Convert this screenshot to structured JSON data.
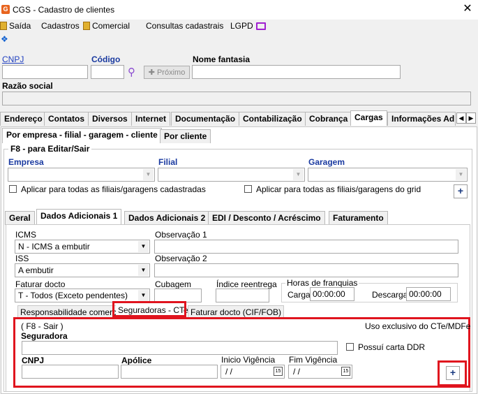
{
  "window": {
    "title": "CGS - Cadastro de clientes",
    "close": "✕"
  },
  "menu": {
    "saida": "Saída",
    "cadastros": "Cadastros",
    "comercial": "Comercial",
    "consultas": "Consultas cadastrais",
    "lgpd": "LGPD"
  },
  "top": {
    "cnpj_label": "CNPJ",
    "codigo_label": "Código",
    "proximo_label": "Próximo",
    "nome_fantasia_label": "Nome fantasia",
    "razao_social_label": "Razão social"
  },
  "main_tabs": [
    "Endereço",
    "Contatos",
    "Diversos",
    "Internet",
    "Documentação",
    "Contabilização",
    "Cobrança",
    "Cargas",
    "Informações Adi"
  ],
  "sub_tabs": [
    "Por empresa - filial - garagem - cliente",
    "Por cliente"
  ],
  "group": {
    "title": "F8 - para Editar/Sair",
    "empresa_label": "Empresa",
    "filial_label": "Filial",
    "garagem_label": "Garagem",
    "aplicar_filiais": "Aplicar para todas as filiais/garagens cadastradas",
    "aplicar_grid": "Aplicar para todas as filiais/garagens do grid",
    "add": "+"
  },
  "inner_tabs": [
    "Geral",
    "Dados Adicionais 1",
    "Dados Adicionais 2",
    "EDI / Desconto / Acréscimo",
    "Faturamento"
  ],
  "form": {
    "icms_label": "ICMS",
    "icms_value": "N - ICMS a embutir",
    "obs1_label": "Observação 1",
    "iss_label": "ISS",
    "iss_value": "A embutir",
    "obs2_label": "Observação 2",
    "faturar_label": "Faturar docto",
    "faturar_value": "T - Todos (Exceto pendentes)",
    "cubagem_label": "Cubagem",
    "indice_label": "Índice reentrega",
    "horas_label": "Horas de franquias",
    "carga_label": "Carga",
    "carga_value": "00:00:00",
    "descarga_label": "Descarga",
    "descarga_value": "00:00:00"
  },
  "bottom_tabs": [
    "Responsabilidade comercial",
    "Seguradoras - CTe",
    "Faturar docto (CIF/FOB)"
  ],
  "seguradoras": {
    "f8": "( F8 - Sair )",
    "uso": "Uso exclusivo do CTe/MDFe",
    "seguradora_label": "Seguradora",
    "possui_ddr": "Possuí carta DDR",
    "cnpj_label": "CNPJ",
    "apolice_label": "Apólice",
    "inicio_label": "Inicio Vigência",
    "inicio_value": "/ /",
    "fim_label": "Fim Vigência",
    "fim_value": "/ /",
    "add": "+"
  }
}
